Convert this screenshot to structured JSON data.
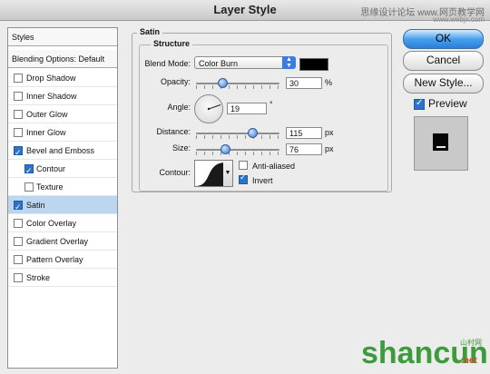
{
  "window": {
    "title": "Layer Style"
  },
  "watermark": {
    "line1": "思缘设计论坛 www.网页教学网",
    "line2": "www.webjx.com",
    "logo": "shancun",
    "logo_cn": "山村网",
    "logo_net": ".net"
  },
  "sidebar": {
    "header_styles": "Styles",
    "header_blending": "Blending Options: Default",
    "items": [
      {
        "label": "Drop Shadow",
        "checked": false
      },
      {
        "label": "Inner Shadow",
        "checked": false
      },
      {
        "label": "Outer Glow",
        "checked": false
      },
      {
        "label": "Inner Glow",
        "checked": false
      },
      {
        "label": "Bevel and Emboss",
        "checked": true
      },
      {
        "label": "Contour",
        "checked": true
      },
      {
        "label": "Texture",
        "checked": false
      },
      {
        "label": "Satin",
        "checked": true,
        "selected": true
      },
      {
        "label": "Color Overlay",
        "checked": false
      },
      {
        "label": "Gradient Overlay",
        "checked": false
      },
      {
        "label": "Pattern Overlay",
        "checked": false
      },
      {
        "label": "Stroke",
        "checked": false
      }
    ]
  },
  "satin": {
    "panel_title": "Satin",
    "structure_title": "Structure",
    "blend_mode_label": "Blend Mode:",
    "blend_mode_value": "Color Burn",
    "color_swatch": "#000000",
    "opacity_label": "Opacity:",
    "opacity_value": "30",
    "opacity_unit": "%",
    "angle_label": "Angle:",
    "angle_value": "19",
    "angle_unit": "°",
    "distance_label": "Distance:",
    "distance_value": "115",
    "distance_unit": "px",
    "size_label": "Size:",
    "size_value": "76",
    "size_unit": "px",
    "contour_label": "Contour:",
    "anti_aliased_label": "Anti-aliased",
    "anti_aliased_checked": false,
    "invert_label": "Invert",
    "invert_checked": true
  },
  "buttons": {
    "ok": "OK",
    "cancel": "Cancel",
    "new_style": "New Style..."
  },
  "preview": {
    "label": "Preview",
    "checked": true
  }
}
